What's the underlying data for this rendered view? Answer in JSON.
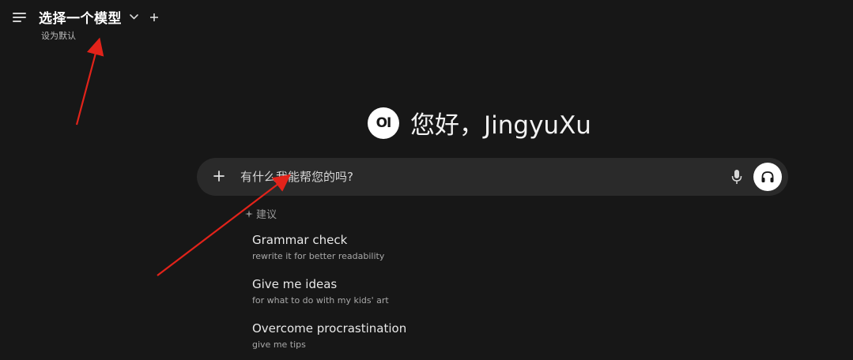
{
  "header": {
    "model_title": "选择一个模型",
    "set_default": "设为默认"
  },
  "greeting": {
    "logo_text": "OI",
    "text": "您好，JingyuXu"
  },
  "input": {
    "placeholder": "有什么我能帮您的吗?"
  },
  "suggestions": {
    "heading": "建议",
    "items": [
      {
        "title": "Grammar check",
        "subtitle": "rewrite it for better readability"
      },
      {
        "title": "Give me ideas",
        "subtitle": "for what to do with my kids' art"
      },
      {
        "title": "Overcome procrastination",
        "subtitle": "give me tips"
      }
    ]
  },
  "colors": {
    "background": "#171717",
    "input_bg": "#2a2a2a",
    "annotation_arrow": "#e2231a"
  },
  "icons": {
    "menu": "menu-icon",
    "chevron": "chevron-down-icon",
    "new_chat": "plus-icon",
    "attach": "plus-icon",
    "mic": "microphone-icon",
    "voice": "headphones-icon",
    "suggestion": "sparkle-icon"
  }
}
